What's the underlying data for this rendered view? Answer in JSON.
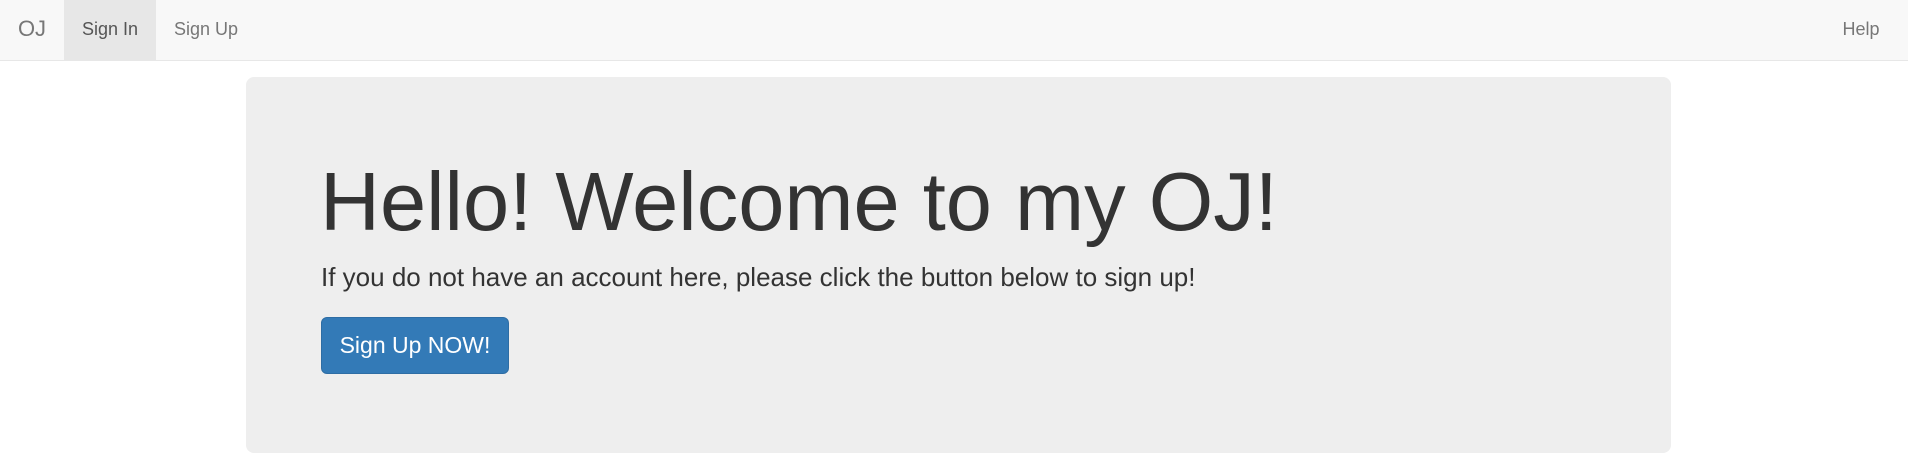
{
  "navbar": {
    "brand": "OJ",
    "items": [
      {
        "label": "Sign In",
        "active": true
      },
      {
        "label": "Sign Up",
        "active": false
      }
    ],
    "right_items": [
      {
        "label": "Help"
      }
    ]
  },
  "hero": {
    "title": "Hello! Welcome to my OJ!",
    "text": "If you do not have an account here, please click the button below to sign up!",
    "button_label": "Sign Up NOW!"
  },
  "colors": {
    "navbar_bg": "#f8f8f8",
    "active_nav_bg": "#e7e7e7",
    "jumbotron_bg": "#eeeeee",
    "primary_button": "#337ab7"
  }
}
